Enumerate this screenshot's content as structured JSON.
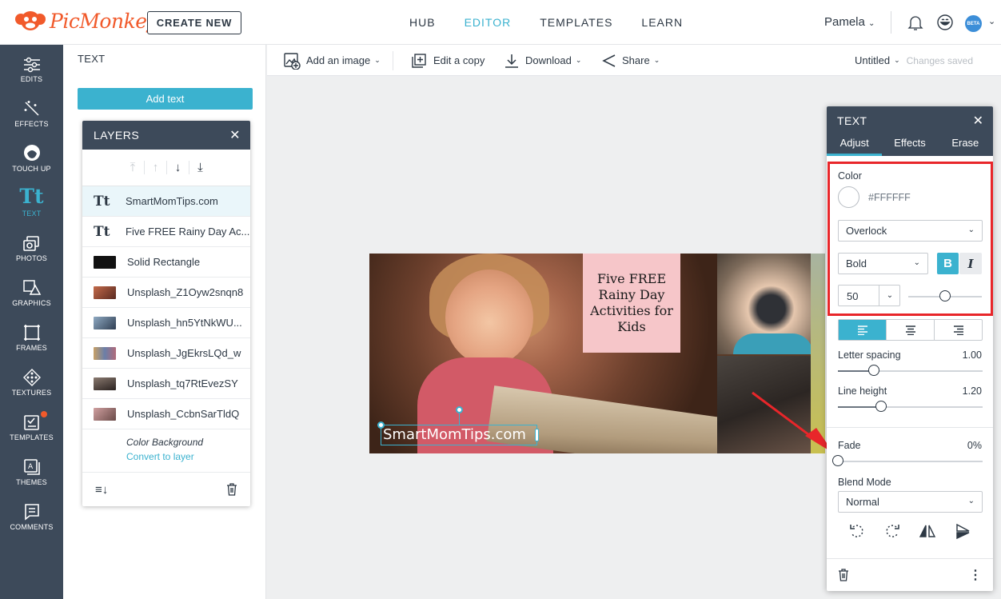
{
  "app": {
    "brand": "PicMonkey",
    "create_label": "CREATE NEW"
  },
  "topnav": [
    {
      "label": "HUB"
    },
    {
      "label": "EDITOR",
      "active": true
    },
    {
      "label": "TEMPLATES"
    },
    {
      "label": "LEARN"
    }
  ],
  "user": {
    "name": "Pamela",
    "beta_badge": "BETA"
  },
  "rail": [
    {
      "label": "EDITS",
      "icon": "sliders-icon"
    },
    {
      "label": "EFFECTS",
      "icon": "magic-wand-icon"
    },
    {
      "label": "TOUCH UP",
      "icon": "face-icon"
    },
    {
      "label": "TEXT",
      "icon": "text-icon",
      "active": true
    },
    {
      "label": "PHOTOS",
      "icon": "photos-icon"
    },
    {
      "label": "GRAPHICS",
      "icon": "graphics-icon"
    },
    {
      "label": "FRAMES",
      "icon": "frames-icon"
    },
    {
      "label": "TEXTURES",
      "icon": "textures-icon"
    },
    {
      "label": "TEMPLATES",
      "icon": "templates-icon"
    },
    {
      "label": "THEMES",
      "icon": "themes-icon"
    },
    {
      "label": "COMMENTS",
      "icon": "comments-icon"
    }
  ],
  "left_panel": {
    "title": "TEXT",
    "add_text": "Add text"
  },
  "layers": {
    "title": "LAYERS",
    "items": [
      {
        "type": "text",
        "icon": "Tt",
        "name": "SmartMomTips.com",
        "selected": true
      },
      {
        "type": "text",
        "icon": "Tt",
        "name": "Five FREE Rainy Day Ac..."
      },
      {
        "type": "shape",
        "name": "Solid Rectangle",
        "color": "#111111"
      },
      {
        "type": "image",
        "name": "Unsplash_Z1Oyw2snqn8",
        "color": "#9b4a3a"
      },
      {
        "type": "image",
        "name": "Unsplash_hn5YtNkWU...",
        "color": "#4a6a8a"
      },
      {
        "type": "image",
        "name": "Unsplash_JgEkrsLQd_w",
        "color": "#7a8aa0"
      },
      {
        "type": "image",
        "name": "Unsplash_tq7RtEvezSY",
        "color": "#4a3a34"
      },
      {
        "type": "image",
        "name": "Unsplash_CcbnSarTldQ",
        "color": "#8a6a6a"
      }
    ],
    "color_background": "Color Background",
    "convert_label": "Convert to layer"
  },
  "toolbar": {
    "add_image": "Add an image",
    "edit_copy": "Edit a copy",
    "download": "Download",
    "share": "Share",
    "doc_title": "Untitled",
    "save_status": "Changes saved"
  },
  "canvas": {
    "headline": "Five FREE Rainy Day Activities for Kids",
    "caption": "SmartMomTips.com"
  },
  "text_panel": {
    "title": "TEXT",
    "tabs": [
      {
        "label": "Adjust",
        "active": true
      },
      {
        "label": "Effects"
      },
      {
        "label": "Erase"
      }
    ],
    "color_label": "Color",
    "color_hex": "#FFFFFF",
    "font": "Overlock",
    "weight": "Bold",
    "bold_label": "B",
    "italic_label": "I",
    "size": "50",
    "size_slider": 0.5,
    "letter_spacing_label": "Letter spacing",
    "letter_spacing": "1.00",
    "letter_spacing_slider": 0.25,
    "line_height_label": "Line height",
    "line_height": "1.20",
    "line_height_slider": 0.3,
    "fade_label": "Fade",
    "fade": "0%",
    "fade_slider": 0,
    "blend_label": "Blend Mode",
    "blend": "Normal"
  },
  "colors": {
    "accent": "#3bb2cf",
    "rail": "#3d4a5a",
    "brand": "#f15a2b",
    "highlight": "#e8262a"
  }
}
